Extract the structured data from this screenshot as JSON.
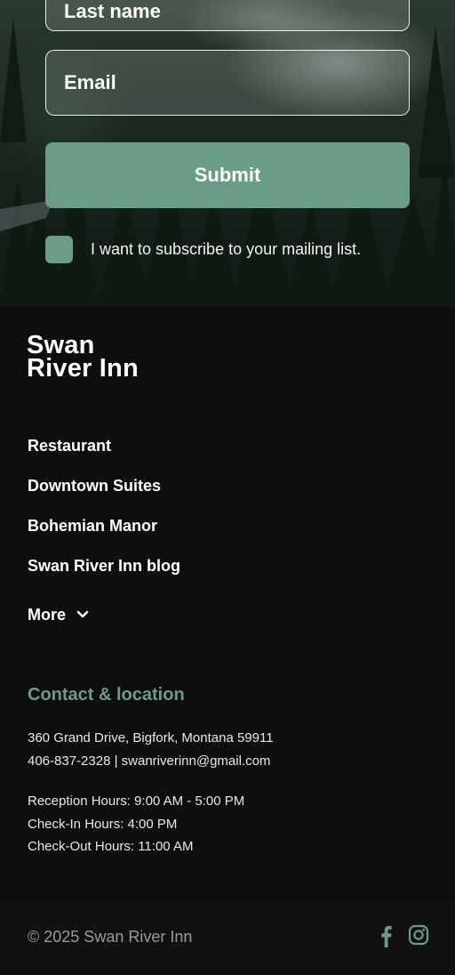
{
  "form": {
    "last_name_placeholder": "Last name",
    "email_placeholder": "Email",
    "submit_label": "Submit",
    "subscribe_label": "I want to subscribe to your mailing list.",
    "subscribe_checked": false
  },
  "brand": {
    "logo_line1": "Swan",
    "logo_line2": "River Inn"
  },
  "nav": {
    "items": [
      {
        "label": "Restaurant"
      },
      {
        "label": "Downtown Suites"
      },
      {
        "label": "Bohemian Manor"
      },
      {
        "label": "Swan River Inn blog"
      }
    ],
    "more_label": "More"
  },
  "contact": {
    "title": "Contact & location",
    "address": "360 Grand Drive, Bigfork, Montana 59911",
    "phone_email": "406-837-2328 | swanriverinn@gmail.com",
    "reception_hours": "Reception Hours: 9:00 AM - 5:00 PM",
    "checkin_hours": "Check-In Hours: 4:00 PM",
    "checkout_hours": "Check-Out Hours: 11:00 AM"
  },
  "footer": {
    "copyright": "© 2025 Swan River Inn",
    "social": [
      "facebook-icon",
      "instagram-icon"
    ]
  },
  "colors": {
    "accent": "#6a9c86",
    "background": "#0e0e0e",
    "text": "#ffffff"
  }
}
